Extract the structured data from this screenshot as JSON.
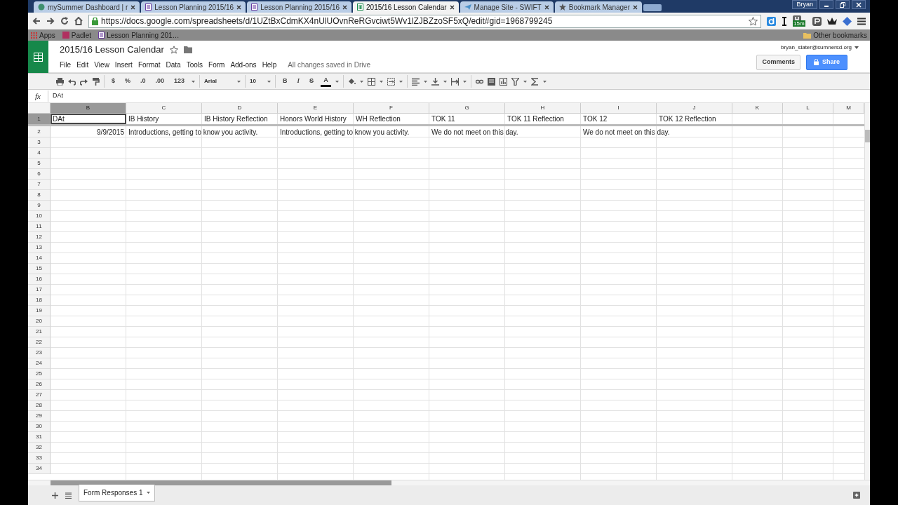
{
  "browser": {
    "tabs": [
      {
        "label": "mySummer Dashboard | r",
        "kind": "site",
        "selected": false
      },
      {
        "label": "Lesson Planning 2015/16",
        "kind": "doc",
        "selected": false
      },
      {
        "label": "Lesson Planning 2015/16",
        "kind": "doc",
        "selected": false
      },
      {
        "label": "2015/16 Lesson Calendar",
        "kind": "sheet",
        "selected": true
      },
      {
        "label": "Manage Site - SWIFT",
        "kind": "plane",
        "selected": false
      },
      {
        "label": "Bookmark Manager",
        "kind": "star",
        "selected": false
      }
    ],
    "user": "Bryan",
    "url": "https://docs.google.com/spreadsheets/d/1UZtBxCdmKX4nUlUOvnReRGvciwt5Wv1lZJBZzoSF5xQ/edit#gid=1968799245",
    "extension_badge": "15m",
    "bookmarks": [
      {
        "label": "Apps",
        "kind": "apps"
      },
      {
        "label": "Padlet",
        "kind": "padlet"
      },
      {
        "label": "Lesson Planning 201…",
        "kind": "doc"
      }
    ],
    "other_bookmarks": "Other bookmarks"
  },
  "document": {
    "title": "2015/16 Lesson Calendar",
    "menus": [
      "File",
      "Edit",
      "View",
      "Insert",
      "Format",
      "Data",
      "Tools",
      "Form",
      "Add-ons",
      "Help"
    ],
    "save_status": "All changes saved in Drive",
    "account": "bryan_slater@sumnersd.org",
    "comments_button": "Comments",
    "share_button": "Share"
  },
  "toolbar": {
    "number_formats": [
      "$",
      "%",
      ".0",
      ".00",
      "123"
    ],
    "font": "Arial",
    "font_size": "10",
    "text_styles": [
      "B",
      "I",
      "S",
      "A"
    ]
  },
  "formula_bar": {
    "label": "fx",
    "value": "DAt"
  },
  "grid": {
    "columns": [
      {
        "letter": "B",
        "selected": true
      },
      {
        "letter": "C",
        "selected": false
      },
      {
        "letter": "D",
        "selected": false
      },
      {
        "letter": "E",
        "selected": false
      },
      {
        "letter": "F",
        "selected": false
      },
      {
        "letter": "G",
        "selected": false
      },
      {
        "letter": "H",
        "selected": false
      },
      {
        "letter": "I",
        "selected": false
      },
      {
        "letter": "J",
        "selected": false
      },
      {
        "letter": "K",
        "selected": false
      },
      {
        "letter": "L",
        "selected": false
      },
      {
        "letter": "M",
        "selected": false
      }
    ],
    "rows": [
      {
        "number": "1",
        "selected": true,
        "cells": {
          "B": {
            "kind": "text",
            "text": "DAt",
            "active": true
          },
          "C": {
            "kind": "text",
            "text": "IB History",
            "active": false
          },
          "D": {
            "kind": "text",
            "text": "IB History Reflection",
            "active": false
          },
          "E": {
            "kind": "text",
            "text": "Honors World History",
            "active": false
          },
          "F": {
            "kind": "text",
            "text": "WH Reflection",
            "active": false
          },
          "G": {
            "kind": "text",
            "text": "TOK 11",
            "active": false
          },
          "H": {
            "kind": "text",
            "text": "TOK 11 Reflection",
            "active": false
          },
          "I": {
            "kind": "text",
            "text": "TOK 12",
            "active": false
          },
          "J": {
            "kind": "text",
            "text": "TOK 12 Reflection",
            "active": false
          }
        }
      },
      {
        "number": "2",
        "selected": false,
        "cells": {
          "B": {
            "kind": "date",
            "text": "9/9/2015",
            "active": false
          },
          "C": {
            "kind": "text",
            "text": "Introductions, getting to know you activity.",
            "active": false
          },
          "E": {
            "kind": "text",
            "text": "Introductions, getting to know you activity.",
            "active": false
          },
          "G": {
            "kind": "text",
            "text": "We do not meet on this day.",
            "active": false
          },
          "I": {
            "kind": "text",
            "text": "We do not meet on this day.",
            "active": false
          }
        }
      },
      {
        "number": "3",
        "selected": false
      },
      {
        "number": "4",
        "selected": false
      },
      {
        "number": "5",
        "selected": false
      },
      {
        "number": "6",
        "selected": false
      },
      {
        "number": "7",
        "selected": false
      },
      {
        "number": "8",
        "selected": false
      },
      {
        "number": "9",
        "selected": false
      },
      {
        "number": "10",
        "selected": false
      },
      {
        "number": "11",
        "selected": false
      },
      {
        "number": "12",
        "selected": false
      },
      {
        "number": "13",
        "selected": false
      },
      {
        "number": "14",
        "selected": false
      },
      {
        "number": "15",
        "selected": false
      },
      {
        "number": "16",
        "selected": false
      },
      {
        "number": "17",
        "selected": false
      },
      {
        "number": "18",
        "selected": false
      },
      {
        "number": "19",
        "selected": false
      },
      {
        "number": "20",
        "selected": false
      },
      {
        "number": "21",
        "selected": false
      },
      {
        "number": "22",
        "selected": false
      },
      {
        "number": "23",
        "selected": false
      },
      {
        "number": "24",
        "selected": false
      },
      {
        "number": "25",
        "selected": false
      },
      {
        "number": "26",
        "selected": false
      },
      {
        "number": "27",
        "selected": false
      },
      {
        "number": "28",
        "selected": false
      },
      {
        "number": "29",
        "selected": false
      },
      {
        "number": "30",
        "selected": false
      },
      {
        "number": "31",
        "selected": false
      },
      {
        "number": "32",
        "selected": false
      },
      {
        "number": "33",
        "selected": false
      },
      {
        "number": "34",
        "selected": false
      }
    ]
  },
  "sheet_tabs": [
    {
      "label": "Form Responses 1",
      "selected": true
    }
  ]
}
